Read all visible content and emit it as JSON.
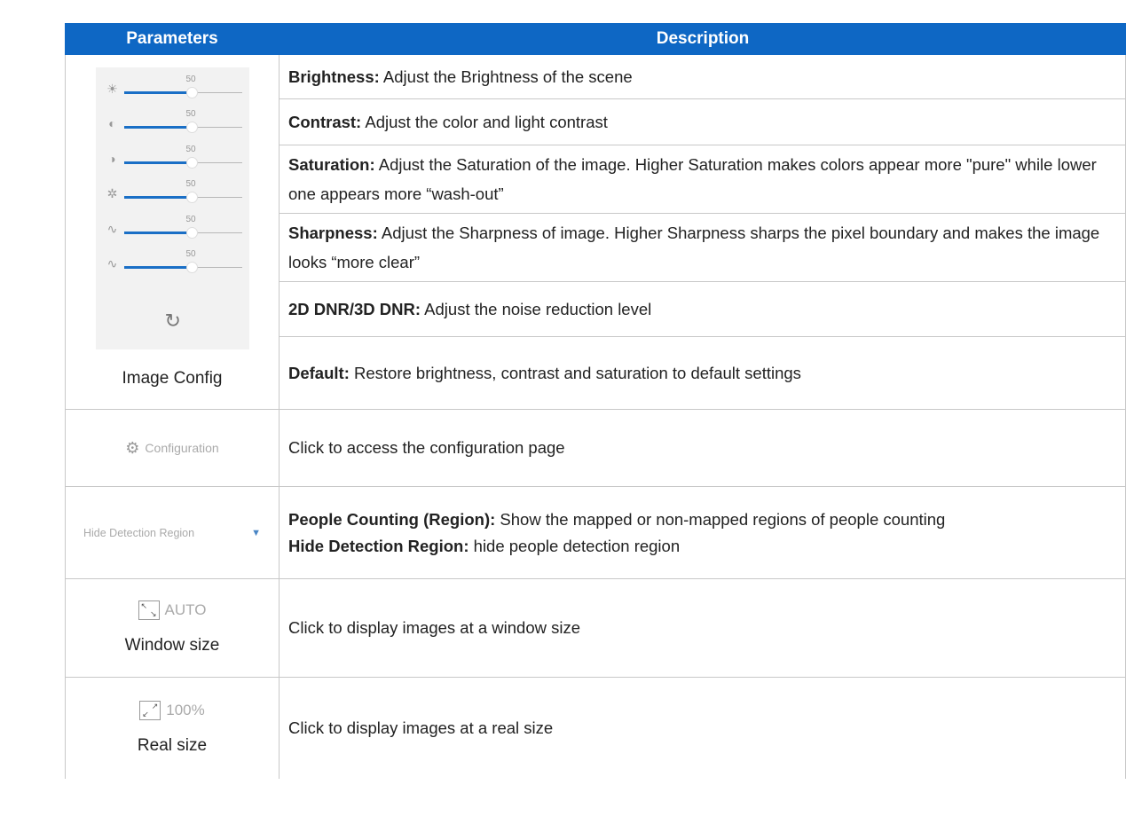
{
  "header": {
    "parameters": "Parameters",
    "description": "Description"
  },
  "image_config": {
    "label": "Image Config",
    "sliders": [
      {
        "icon": "sun-icon",
        "glyph": "☀",
        "value": "50"
      },
      {
        "icon": "contrast-icon",
        "glyph": "◐",
        "value": "50"
      },
      {
        "icon": "saturation-icon",
        "glyph": "◑",
        "value": "50"
      },
      {
        "icon": "dnr-icon",
        "glyph": "✲",
        "value": "50"
      },
      {
        "icon": "sharpness-icon",
        "glyph": "∿",
        "value": "50"
      },
      {
        "icon": "noise-icon",
        "glyph": "∿",
        "value": "50"
      }
    ],
    "reset_glyph": "↻",
    "rows": [
      {
        "term": "Brightness:",
        "text": " Adjust the Brightness of the scene"
      },
      {
        "term": "Contrast:",
        "text": " Adjust the color and light contrast"
      },
      {
        "term": "Saturation:",
        "text": " Adjust the Saturation of the image. Higher Saturation makes colors appear more \"pure\" while lower one appears more “wash-out”"
      },
      {
        "term": "Sharpness:",
        "text": " Adjust the Sharpness of image. Higher Sharpness sharps the pixel boundary and makes the image looks “more clear”"
      },
      {
        "term": "2D DNR/3D DNR:",
        "text": " Adjust the noise reduction level"
      },
      {
        "term": "Default:",
        "text": " Restore brightness, contrast and saturation to default settings"
      }
    ]
  },
  "configuration": {
    "button_label": "Configuration",
    "description": "Click to access the configuration page"
  },
  "region": {
    "dropdown_value": "Hide Detection Region",
    "term1": "People Counting (Region):",
    "text1": " Show the mapped or non-mapped regions of people counting",
    "term2": "Hide Detection Region:",
    "text2": " hide people detection region"
  },
  "window_size": {
    "button_label": "AUTO",
    "label": "Window size",
    "description": "Click to display images at a window size"
  },
  "real_size": {
    "button_label": "100%",
    "label": "Real size",
    "description": "Click to display images at a real size"
  }
}
